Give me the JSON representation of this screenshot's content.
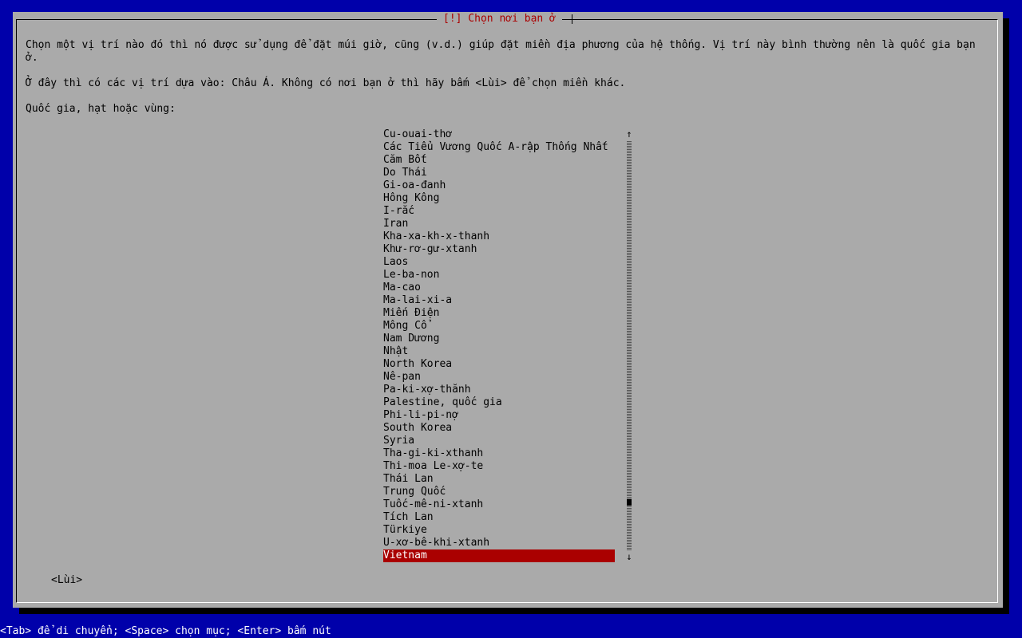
{
  "dialog": {
    "title": "[!] Chọn nơi bạn ở",
    "description": "Chọn một vị trí nào đó thì nó được sử dụng để đặt múi giờ, cũng (v.d.) giúp đặt miền địa phương của hệ thống. Vị trí này bình thường nên là quốc gia bạn ở.",
    "info": "Ở đây thì có các vị trí dựa vào: Châu Á. Không có nơi bạn ở thì hãy bấm <Lùi> để chọn miền khác.",
    "prompt": "Quốc gia, hạt hoặc vùng:",
    "countries": [
      "Cu-ouai-thơ",
      "Các Tiểu Vương Quốc A-rập Thống Nhất",
      "Căm Bốt",
      "Do Thái",
      "Gi-oa-đanh",
      "Hông Kông",
      "I-rắc",
      "Iran",
      "Kha-xa-kh-x-thanh",
      "Khư-rơ-gư-xtanh",
      "Laos",
      "Le-ba-non",
      "Ma-cao",
      "Ma-lai-xi-a",
      "Miến Điện",
      "Mông Cổ",
      "Nam Dương",
      "Nhật",
      "North Korea",
      "Nê-pan",
      "Pa-ki-xợ-thănh",
      "Palestine, quốc gia",
      "Phi-li-pi-nợ",
      "South Korea",
      "Syria",
      "Tha-gi-ki-xthanh",
      "Thi-moa Le-xợ-te",
      "Thái Lan",
      "Trung Quốc",
      "Tuốc-mê-ni-xtanh",
      "Tích Lan",
      "Türkiye",
      "U-xơ-bê-khi-xtanh",
      "Vietnam"
    ],
    "selected_country": "Vietnam",
    "scroll_position": 0.89,
    "back_button": "<Lùi>"
  },
  "footer": {
    "help": "<Tab> để di chuyển; <Space> chọn mục; <Enter> bấm nút"
  },
  "colors": {
    "background": "#0000aa",
    "dialog": "#aaaaaa",
    "title": "#aa0000",
    "selection": "#aa0000"
  },
  "icons": {
    "scroll_up": "up-arrow-icon",
    "scroll_down": "down-arrow-icon"
  }
}
